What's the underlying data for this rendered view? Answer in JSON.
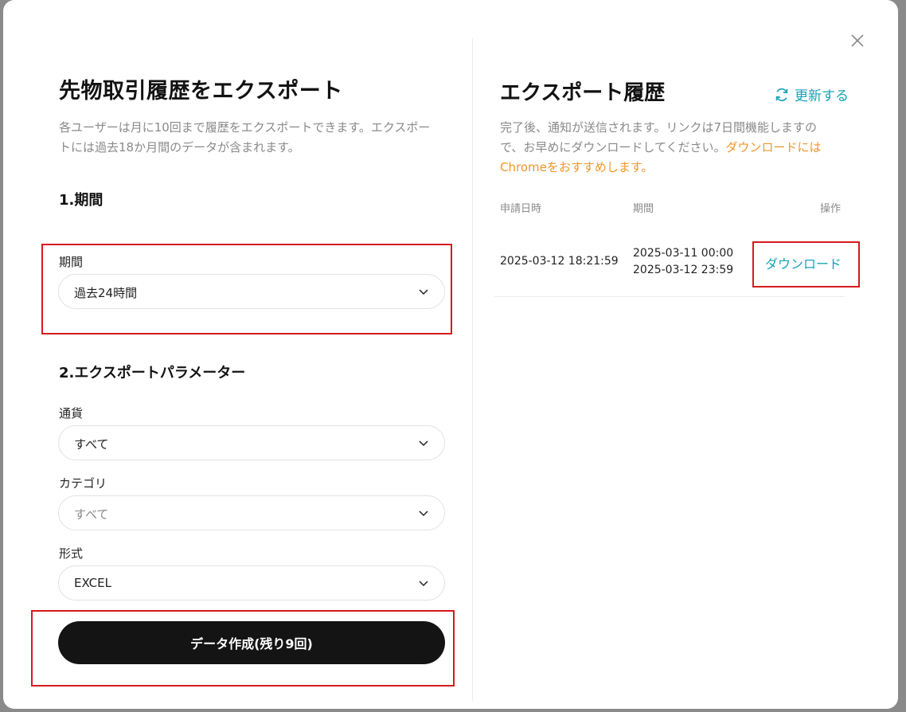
{
  "left": {
    "title": "先物取引履歴をエクスポート",
    "description": "各ユーザーは月に10回まで履歴をエクスポートできます。エクスポートには過去18か月間のデータが含まれます。",
    "section1": "1.期間",
    "period": {
      "label": "期間",
      "value": "過去24時間"
    },
    "section2": "2.エクスポートパラメーター",
    "currency": {
      "label": "通貨",
      "value": "すべて"
    },
    "category": {
      "label": "カテゴリ",
      "value": "すべて"
    },
    "format": {
      "label": "形式",
      "value": "EXCEL"
    },
    "submit_label": "データ作成(残り9回)"
  },
  "right": {
    "title": "エクスポート履歴",
    "refresh_label": "更新する",
    "description_plain": "完了後、通知が送信されます。リンクは7日間機能しますので、お早めにダウンロードしてください。",
    "description_highlight": "ダウンロードにはChromeをおすすめします。",
    "columns": [
      "申請日時",
      "期間",
      "操作"
    ],
    "rows": [
      {
        "requested_at": "2025-03-12 18:21:59",
        "period_start": "2025-03-11 00:00",
        "period_end": "2025-03-12 23:59",
        "action": "ダウンロード"
      }
    ]
  },
  "colors": {
    "accent": "#1aa3b5",
    "highlight_text": "#f0962a",
    "annotation_box": "#d7191c",
    "primary_button": "#141414"
  },
  "icons": {
    "close": "close-icon",
    "refresh": "refresh-icon",
    "dropdown": "chevron-down-icon"
  }
}
